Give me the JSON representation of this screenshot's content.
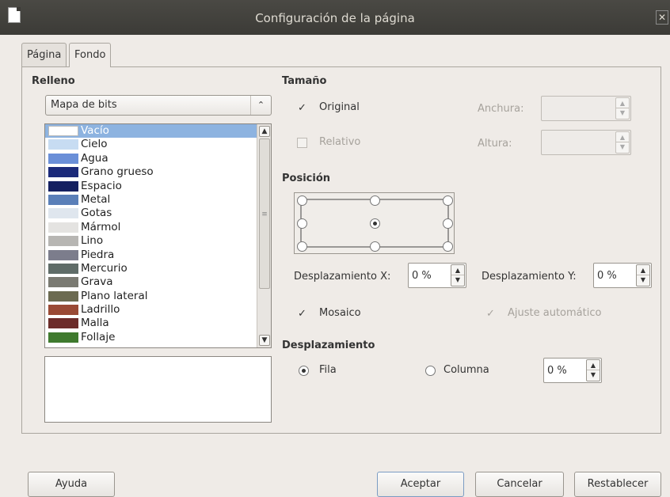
{
  "window": {
    "title": "Configuración de la página"
  },
  "tabs": [
    {
      "label": "Página"
    },
    {
      "label": "Fondo"
    }
  ],
  "fill": {
    "heading": "Relleno",
    "selected_type": "Mapa de bits",
    "bitmaps": [
      {
        "label": "Vacío",
        "color": "#ffffff",
        "selected": true
      },
      {
        "label": "Cielo",
        "color": "#c7dcf2"
      },
      {
        "label": "Agua",
        "color": "#6a8fd8"
      },
      {
        "label": "Grano grueso",
        "color": "#1b2a7a"
      },
      {
        "label": "Espacio",
        "color": "#142060"
      },
      {
        "label": "Metal",
        "color": "#5a7fb8"
      },
      {
        "label": "Gotas",
        "color": "#dfe6ee"
      },
      {
        "label": "Mármol",
        "color": "#e4e3e1"
      },
      {
        "label": "Lino",
        "color": "#b7b6b3"
      },
      {
        "label": "Piedra",
        "color": "#7c7d8c"
      },
      {
        "label": "Mercurio",
        "color": "#5f6c68"
      },
      {
        "label": "Grava",
        "color": "#7a7a72"
      },
      {
        "label": "Plano lateral",
        "color": "#6b6a50"
      },
      {
        "label": "Ladrillo",
        "color": "#9a4a35"
      },
      {
        "label": "Malla",
        "color": "#6c2c2a"
      },
      {
        "label": "Follaje",
        "color": "#3f7a2e"
      }
    ]
  },
  "size": {
    "heading": "Tamaño",
    "original_label": "Original",
    "original_checked": true,
    "relative_label": "Relativo",
    "relative_checked": false,
    "width_label": "Anchura:",
    "width_value": "",
    "height_label": "Altura:",
    "height_value": ""
  },
  "position": {
    "heading": "Posición",
    "offset_x_label": "Desplazamiento X:",
    "offset_x_value": "0 %",
    "offset_y_label": "Desplazamiento Y:",
    "offset_y_value": "0 %",
    "tile_label": "Mosaico",
    "tile_checked": true,
    "autofit_label": "Ajuste automático",
    "autofit_checked": true
  },
  "offset": {
    "heading": "Desplazamiento",
    "row_label": "Fila",
    "row_selected": true,
    "column_label": "Columna",
    "value": "0 %"
  },
  "buttons": {
    "help": "Ayuda",
    "ok": "Aceptar",
    "cancel": "Cancelar",
    "reset": "Restablecer"
  }
}
